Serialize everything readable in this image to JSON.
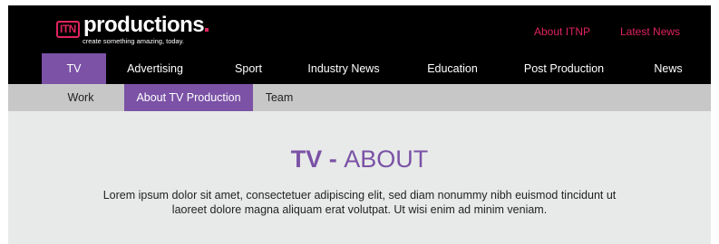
{
  "header": {
    "logo": {
      "mark": "ITN",
      "word": "productions",
      "tagline": "create something amazing, today."
    },
    "links": [
      {
        "label": "About ITNP"
      },
      {
        "label": "Latest News"
      }
    ]
  },
  "nav": {
    "items": [
      {
        "label": "TV",
        "active": true
      },
      {
        "label": "Advertising"
      },
      {
        "label": "Sport"
      },
      {
        "label": "Industry News"
      },
      {
        "label": "Education"
      },
      {
        "label": "Post Production"
      },
      {
        "label": "News"
      }
    ]
  },
  "subnav": {
    "items": [
      {
        "label": "Work"
      },
      {
        "label": "About TV Production",
        "active": true
      },
      {
        "label": "Team"
      }
    ]
  },
  "main": {
    "title_strong": "TV",
    "title_sep": " - ",
    "title_rest": "ABOUT",
    "intro": "Lorem ipsum dolor sit amet, consectetuer adipiscing elit, sed diam nonummy nibh euismod tincidunt ut laoreet dolore magna aliquam erat volutpat. Ut wisi enim ad minim veniam."
  },
  "colors": {
    "accent": "#7b52a6",
    "brand_pink": "#e0245e",
    "header_bg": "#000000",
    "subnav_bg": "#c7c7c7",
    "content_bg": "#e8eae9"
  }
}
